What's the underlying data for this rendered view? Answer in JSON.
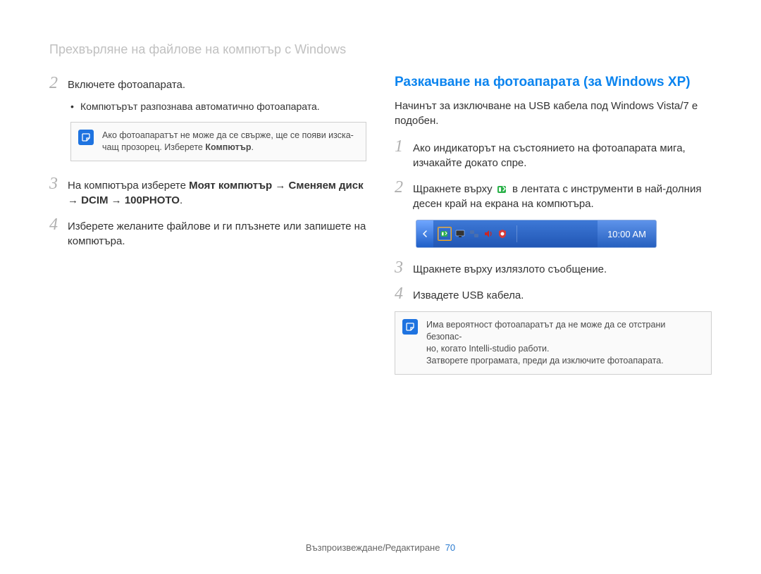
{
  "header": "Прехвърляне на файлове на компютър с Windows",
  "left": {
    "step2": {
      "num": "2",
      "text": "Включете фотоапарата."
    },
    "bullet": "Компютърът разпознава автоматично фотоапарата.",
    "note": {
      "line1": "Ако фотоапаратът не може да се свърже, ще се появи изска-",
      "line2_a": "чащ прозорец. Изберете ",
      "line2_b": "Компютър",
      "line2_c": "."
    },
    "step3": {
      "num": "3",
      "pre": "На компютъра изберете ",
      "b1": "Моят компютър",
      "arrow1": " → ",
      "b2": "Сменяем диск",
      "arrow2": " → ",
      "b3": "DCIM",
      "arrow3": " → ",
      "b4": "100PHOTO",
      "end": "."
    },
    "step4": {
      "num": "4",
      "text": "Изберете желаните файлове и ги плъзнете или запишете на компютъра."
    }
  },
  "right": {
    "heading": "Разкачване на фотоапарата (за Windows XP)",
    "intro": "Начинът за изключване на USB кабела под Windows Vista/7 е подобен.",
    "step1": {
      "num": "1",
      "text": "Ако индикаторът на състоянието на фотоапарата мига, изчакайте докато спре."
    },
    "step2": {
      "num": "2",
      "pre": "Щракнете върху ",
      "post": " в лентата с инструменти в най-долния десен край на екрана на компютъра."
    },
    "tray_time": "10:00 AM",
    "step3": {
      "num": "3",
      "text": "Щракнете върху излязлото съобщение."
    },
    "step4": {
      "num": "4",
      "text": "Извадете USB кабела."
    },
    "note": {
      "line1": "Има вероятност фотоапаратът да не може да се отстрани безопас-",
      "line2": "но, когато Intelli-studio работи.",
      "line3": "Затворете програмата, преди да изключите фотоапарата."
    }
  },
  "footer": {
    "text": "Възпроизвеждане/Редактиране",
    "page": "70"
  }
}
